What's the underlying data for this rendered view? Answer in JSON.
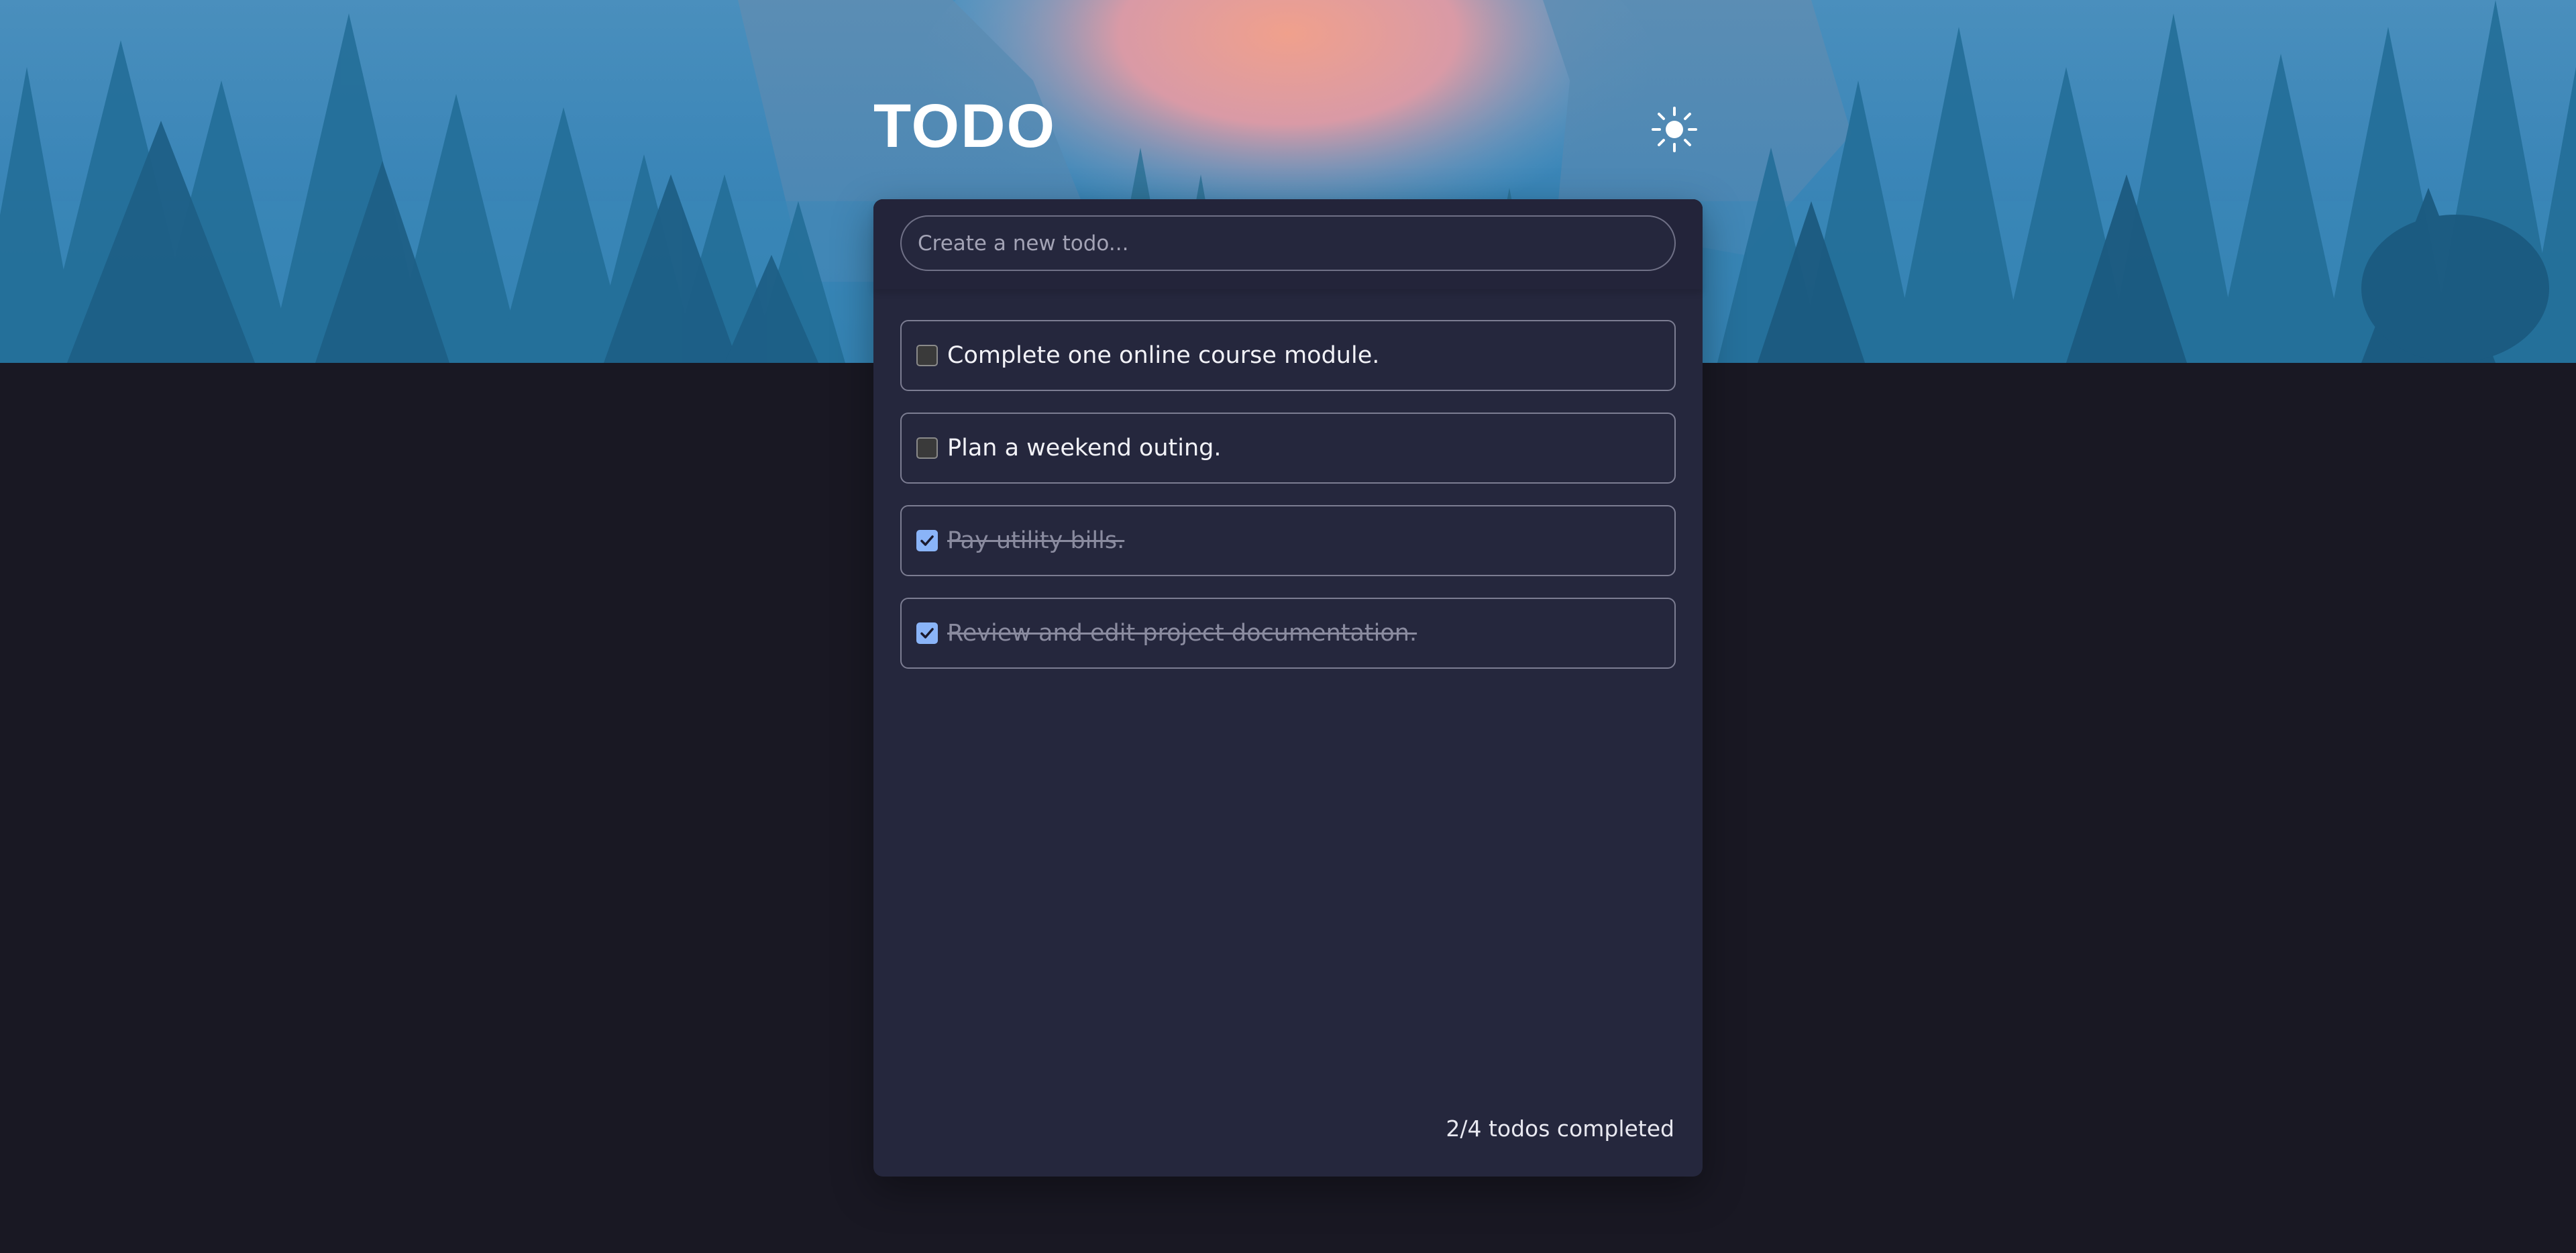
{
  "header": {
    "title": "TODO",
    "theme_toggle_icon": "sun-icon"
  },
  "input": {
    "placeholder": "Create a new todo...",
    "value": ""
  },
  "todos": [
    {
      "text": "Complete one online course module.",
      "completed": false
    },
    {
      "text": "Plan a weekend outing.",
      "completed": false
    },
    {
      "text": "Pay utility bills.",
      "completed": true
    },
    {
      "text": "Review and edit project documentation.",
      "completed": true
    }
  ],
  "footer": {
    "count_label": "2/4 todos completed"
  },
  "colors": {
    "page_background": "#191823",
    "card_background": "#25273d",
    "accent_checkbox": "#8ab4f8",
    "title_text": "#ffffff"
  }
}
